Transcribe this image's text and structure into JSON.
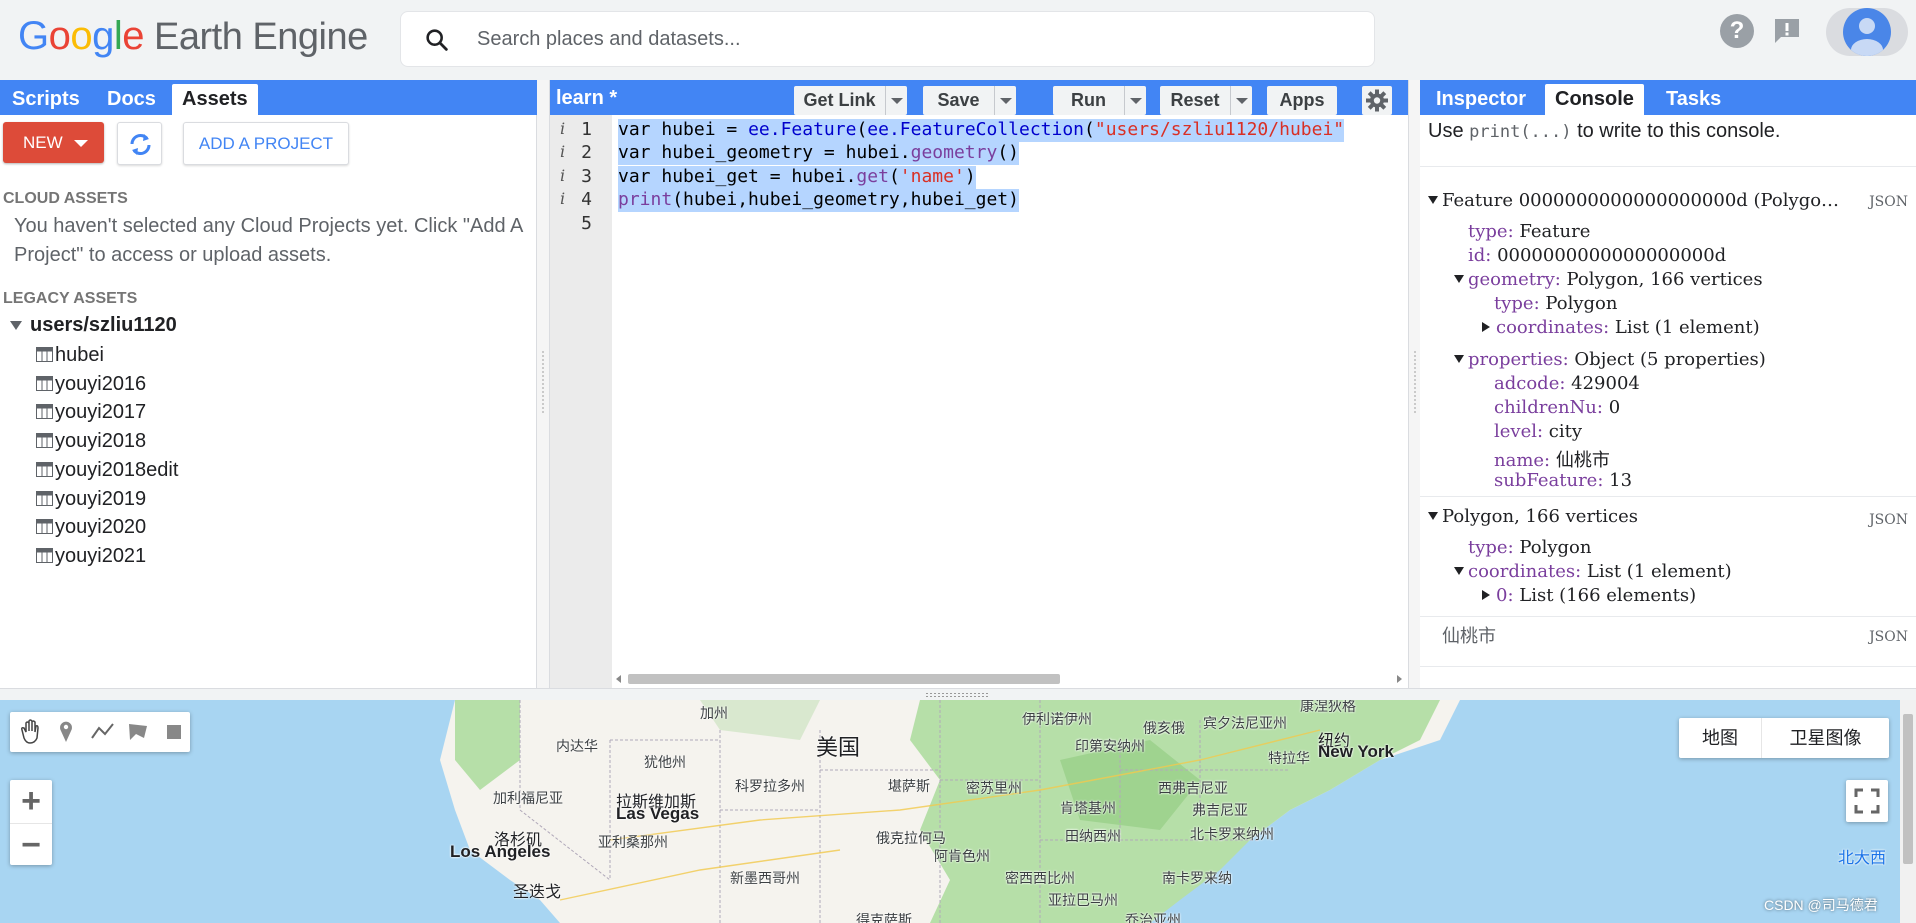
{
  "header": {
    "logo_google": [
      "G",
      "o",
      "o",
      "g",
      "l",
      "e"
    ],
    "logo_product": "Earth Engine",
    "search_placeholder": "Search places and datasets...",
    "help_icon": "question-icon",
    "feedback_icon": "feedback-icon",
    "avatar_icon": "account-avatar"
  },
  "left_panel": {
    "tabs": [
      {
        "label": "Scripts",
        "active": false
      },
      {
        "label": "Docs",
        "active": false
      },
      {
        "label": "Assets",
        "active": true
      }
    ],
    "new_button": "NEW",
    "refresh_icon": "refresh-icon",
    "add_project_button": "ADD A PROJECT",
    "cloud_assets_title": "CLOUD ASSETS",
    "cloud_assets_message": "You haven't selected any Cloud Projects yet. Click \"Add A Project\" to access or upload assets.",
    "legacy_assets_title": "LEGACY ASSETS",
    "tree_root": "users/szliu1120",
    "assets": [
      "hubei",
      "youyi2016",
      "youyi2017",
      "youyi2018",
      "youyi2018edit",
      "youyi2019",
      "youyi2020",
      "youyi2021"
    ]
  },
  "editor": {
    "title": "learn *",
    "buttons": {
      "get_link": "Get Link",
      "save": "Save",
      "run": "Run",
      "reset": "Reset",
      "apps": "Apps"
    },
    "settings_icon": "gear-icon",
    "line_numbers": [
      "1",
      "2",
      "3",
      "4",
      "5"
    ],
    "info_marker": "i",
    "code_lines": [
      "var hubei = ee.Feature(ee.FeatureCollection(\"users/szliu1120/hubei\"",
      "var hubei_geometry = hubei.geometry()",
      "var hubei_get = hubei.get('name')",
      "print(hubei,hubei_geometry,hubei_get)",
      ""
    ]
  },
  "right_panel": {
    "tabs": [
      {
        "label": "Inspector",
        "active": false
      },
      {
        "label": "Console",
        "active": true
      },
      {
        "label": "Tasks",
        "active": false
      }
    ],
    "hint_prefix": "Use",
    "hint_code": "print(...)",
    "hint_suffix": "to write to this console.",
    "json_label": "JSON",
    "feature": {
      "header": "Feature 0000000000000000000d (Polygo…",
      "type_key": "type:",
      "type_val": "Feature",
      "id_key": "id:",
      "id_val": "0000000000000000000d",
      "geometry_key": "geometry:",
      "geometry_val": "Polygon, 166 vertices",
      "geo_type_key": "type:",
      "geo_type_val": "Polygon",
      "coords_key": "coordinates:",
      "coords_val": "List (1 element)",
      "props_key": "properties:",
      "props_val": "Object (5 properties)",
      "properties": [
        {
          "key": "adcode:",
          "val": "429004"
        },
        {
          "key": "childrenNu:",
          "val": "0"
        },
        {
          "key": "level:",
          "val": "city"
        },
        {
          "key": "name:",
          "val": "仙桃市"
        },
        {
          "key": "subFeature:",
          "val": "13"
        }
      ]
    },
    "polygon": {
      "header": "Polygon, 166 vertices",
      "type_key": "type:",
      "type_val": "Polygon",
      "coords_key": "coordinates:",
      "coords_val": "List (1 element)",
      "item0_key": "0:",
      "item0_val": "List (166 elements)"
    },
    "string_output": "仙桃市"
  },
  "map": {
    "map_type_buttons": [
      "地图",
      "卫星图像"
    ],
    "zoom_in": "+",
    "zoom_out": "−",
    "draw_tools": [
      "hand-icon",
      "marker-icon",
      "line-icon",
      "polygon-icon",
      "rectangle-icon"
    ],
    "labels": [
      {
        "text": "加州",
        "cls": ""
      },
      {
        "text": "内达华",
        "cls": ""
      },
      {
        "text": "犹他州",
        "cls": ""
      },
      {
        "text": "美国",
        "cls": "big"
      },
      {
        "text": "科罗拉多州",
        "cls": ""
      },
      {
        "text": "堪萨斯",
        "cls": ""
      },
      {
        "text": "密苏里州",
        "cls": ""
      },
      {
        "text": "伊利诺伊州",
        "cls": ""
      },
      {
        "text": "印第安纳州",
        "cls": ""
      },
      {
        "text": "俄亥俄",
        "cls": ""
      },
      {
        "text": "宾夕法尼亚州",
        "cls": ""
      },
      {
        "text": "纽约",
        "cls": "city"
      },
      {
        "text": "New York",
        "cls": "city-en"
      },
      {
        "text": "特拉华",
        "cls": ""
      },
      {
        "text": "西弗吉尼亚",
        "cls": ""
      },
      {
        "text": "弗吉尼亚",
        "cls": ""
      },
      {
        "text": "肯塔基州",
        "cls": ""
      },
      {
        "text": "田纳西州",
        "cls": ""
      },
      {
        "text": "北卡罗来纳州",
        "cls": ""
      },
      {
        "text": "南卡罗来纳",
        "cls": ""
      },
      {
        "text": "加利福尼亚",
        "cls": ""
      },
      {
        "text": "拉斯维加斯",
        "cls": "city"
      },
      {
        "text": "Las Vegas",
        "cls": "city-en"
      },
      {
        "text": "亚利桑那州",
        "cls": ""
      },
      {
        "text": "新墨西哥州",
        "cls": ""
      },
      {
        "text": "俄克拉何马",
        "cls": ""
      },
      {
        "text": "阿肯色州",
        "cls": ""
      },
      {
        "text": "密西西比州",
        "cls": ""
      },
      {
        "text": "亚拉巴马州",
        "cls": ""
      },
      {
        "text": "洛杉矶",
        "cls": "city"
      },
      {
        "text": "Los Angeles",
        "cls": "city-en"
      },
      {
        "text": "圣迭戈",
        "cls": "city"
      },
      {
        "text": "得克萨斯",
        "cls": ""
      },
      {
        "text": "乔治亚州",
        "cls": ""
      },
      {
        "text": "北大西",
        "cls": "blue"
      },
      {
        "text": "康涅狄格",
        "cls": ""
      }
    ],
    "watermark": "CSDN @司马德君"
  },
  "colors": {
    "accent": "#4285f4",
    "new_button": "#dd4b39",
    "selection": "#b5d5ff",
    "water": "#a8d5f2",
    "land": "#f5f3ee",
    "vegetation": "#b6dfa8"
  }
}
